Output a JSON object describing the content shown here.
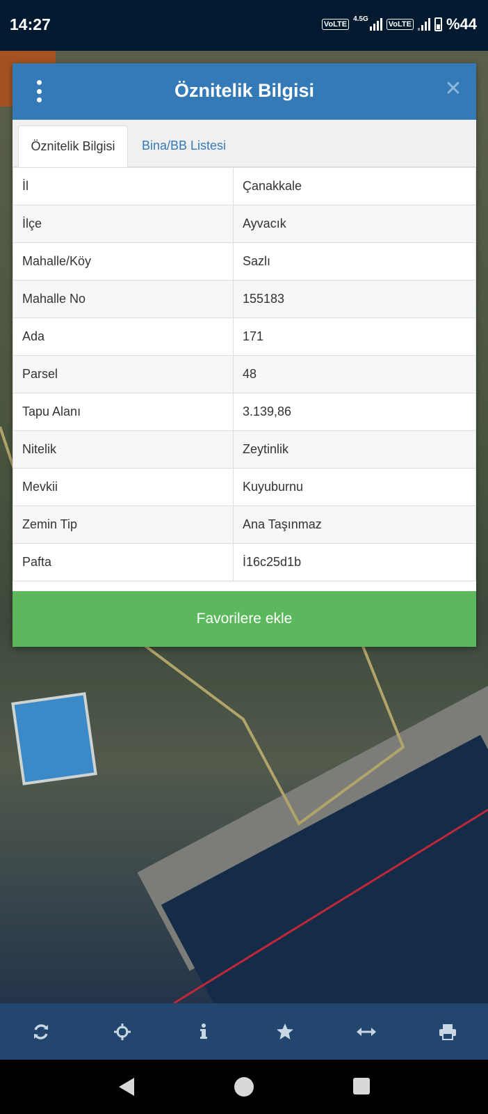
{
  "status_bar": {
    "time": "14:27",
    "volte1": "VoLTE",
    "network": "4.5G",
    "volte2": "VoLTE",
    "battery": "%44"
  },
  "dialog": {
    "title": "Öznitelik Bilgisi",
    "tabs": [
      {
        "label": "Öznitelik Bilgisi",
        "active": true
      },
      {
        "label": "Bina/BB Listesi",
        "active": false
      }
    ],
    "rows": [
      {
        "key": "İl",
        "value": "Çanakkale"
      },
      {
        "key": "İlçe",
        "value": "Ayvacık"
      },
      {
        "key": "Mahalle/Köy",
        "value": "Sazlı"
      },
      {
        "key": "Mahalle No",
        "value": "155183"
      },
      {
        "key": "Ada",
        "value": "171"
      },
      {
        "key": "Parsel",
        "value": "48"
      },
      {
        "key": "Tapu Alanı",
        "value": "3.139,86"
      },
      {
        "key": "Nitelik",
        "value": "Zeytinlik"
      },
      {
        "key": "Mevkii",
        "value": "Kuyuburnu"
      },
      {
        "key": "Zemin Tip",
        "value": "Ana Taşınmaz"
      },
      {
        "key": "Pafta",
        "value": "İ16c25d1b"
      }
    ],
    "favorite_button": "Favorilere ekle"
  },
  "toolbar": {
    "icons": [
      "refresh-icon",
      "crosshair-icon",
      "info-icon",
      "star-icon",
      "measure-icon",
      "print-icon"
    ]
  },
  "colors": {
    "header": "#337ab7",
    "favorite": "#5cb85c",
    "toolbar": "#22466e"
  }
}
